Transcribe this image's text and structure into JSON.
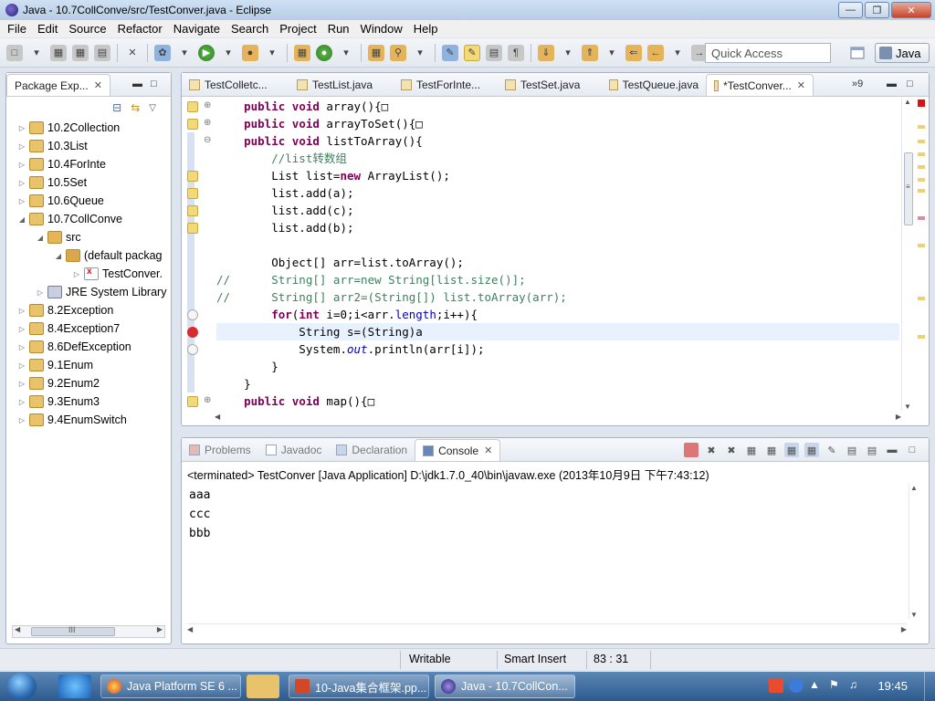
{
  "window": {
    "title": "Java - 10.7CollConve/src/TestConver.java - Eclipse"
  },
  "menu": [
    "File",
    "Edit",
    "Source",
    "Refactor",
    "Navigate",
    "Search",
    "Project",
    "Run",
    "Window",
    "Help"
  ],
  "toolbar": {
    "quick_access_placeholder": "Quick Access",
    "perspective": "Java"
  },
  "package_explorer": {
    "title": "Package Exp...",
    "items": [
      {
        "label": "10.2Collection",
        "level": 0,
        "expanded": false,
        "icon": "project-icon"
      },
      {
        "label": "10.3List",
        "level": 0,
        "expanded": false,
        "icon": "project-icon"
      },
      {
        "label": "10.4ForInte",
        "level": 0,
        "expanded": false,
        "icon": "project-icon"
      },
      {
        "label": "10.5Set",
        "level": 0,
        "expanded": false,
        "icon": "project-icon"
      },
      {
        "label": "10.6Queue",
        "level": 0,
        "expanded": false,
        "icon": "project-icon"
      },
      {
        "label": "10.7CollConve",
        "level": 0,
        "expanded": true,
        "icon": "project-error-icon"
      },
      {
        "label": "src",
        "level": 1,
        "expanded": true,
        "icon": "source-folder-icon"
      },
      {
        "label": "(default packag",
        "level": 2,
        "expanded": true,
        "icon": "package-icon"
      },
      {
        "label": "TestConver.",
        "level": 3,
        "expanded": false,
        "icon": "java-file-error-icon"
      },
      {
        "label": "JRE System Library",
        "level": 1,
        "expanded": false,
        "icon": "library-icon"
      },
      {
        "label": "8.2Exception",
        "level": 0,
        "expanded": false,
        "icon": "project-icon"
      },
      {
        "label": "8.4Exception7",
        "level": 0,
        "expanded": false,
        "icon": "project-icon"
      },
      {
        "label": "8.6DefException",
        "level": 0,
        "expanded": false,
        "icon": "project-icon"
      },
      {
        "label": "9.1Enum",
        "level": 0,
        "expanded": false,
        "icon": "project-icon"
      },
      {
        "label": "9.2Enum2",
        "level": 0,
        "expanded": false,
        "icon": "project-icon"
      },
      {
        "label": "9.3Enum3",
        "level": 0,
        "expanded": false,
        "icon": "project-icon"
      },
      {
        "label": "9.4EnumSwitch",
        "level": 0,
        "expanded": false,
        "icon": "project-icon"
      }
    ],
    "scroll_glyph": "III"
  },
  "editor": {
    "tabs": [
      {
        "label": "TestColletc..."
      },
      {
        "label": "TestList.java"
      },
      {
        "label": "TestForInte..."
      },
      {
        "label": "TestSet.java"
      },
      {
        "label": "TestQueue.java"
      },
      {
        "label": "*TestConver...",
        "active": true
      }
    ],
    "overflow": "9",
    "lines": [
      "    public void array(){□",
      "    public void arrayToSet(){□",
      "    public void listToArray(){",
      "        //list转数组",
      "        List list=new ArrayList();",
      "        list.add(a);",
      "        list.add(c);",
      "        list.add(b);",
      "",
      "        Object[] arr=list.toArray();",
      "//      String[] arr=new String[list.size()];",
      "//      String[] arr2=(String[]) list.toArray(arr);",
      "        for(int i=0;i<arr.length;i++){",
      "            String s=(String)a",
      "            System.out.println(arr[i]);",
      "        }",
      "    }",
      "    public void map(){□"
    ]
  },
  "console": {
    "tabs": [
      {
        "label": "Problems"
      },
      {
        "label": "Javadoc"
      },
      {
        "label": "Declaration"
      },
      {
        "label": "Console",
        "active": true
      }
    ],
    "status": "<terminated> TestConver [Java Application] D:\\jdk1.7.0_40\\bin\\javaw.exe (2013年10月9日 下午7:43:12)",
    "output": [
      "aaa",
      "ccc",
      "bbb"
    ]
  },
  "statusbar": {
    "mode": "Writable",
    "insert": "Smart Insert",
    "position": "83 : 31"
  },
  "taskbar": {
    "tasks": [
      {
        "label": "Java Platform SE 6 ..."
      },
      {
        "label": "10-Java集合框架.pp..."
      },
      {
        "label": "Java - 10.7CollCon...",
        "active": true
      }
    ],
    "clock": "19:45"
  }
}
